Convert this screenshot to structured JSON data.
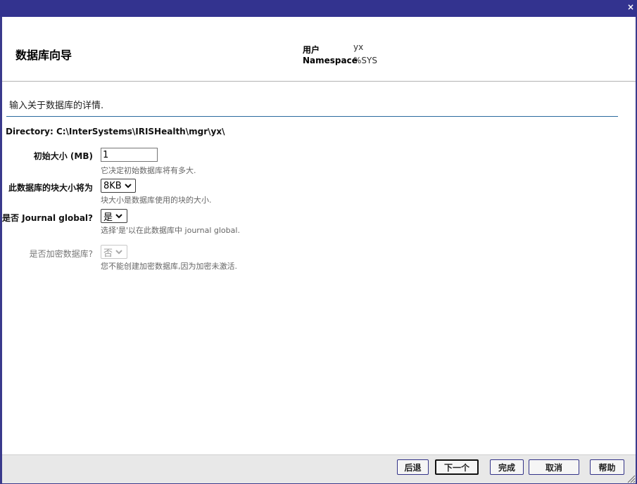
{
  "window": {
    "close_glyph": "×"
  },
  "header": {
    "title": "数据库向导",
    "user_label": "用户",
    "user_value": "yx",
    "namespace_label": "Namespace",
    "namespace_value": "%SYS"
  },
  "intro_text": "输入关于数据库的详情.",
  "directory_text": "Directory: C:\\InterSystems\\IRISHealth\\mgr\\yx\\",
  "form": {
    "initial_size": {
      "label": "初始大小 (MB)",
      "value": "1",
      "hint": "它决定初始数据库将有多大."
    },
    "block_size": {
      "label": "此数据库的块大小将为",
      "value": "8KB",
      "hint": "块大小是数据库使用的块的大小."
    },
    "journal": {
      "label": "是否 Journal global?",
      "value": "是",
      "hint": "选择'是'以在此数据库中 journal global."
    },
    "encrypt": {
      "label": "是否加密数据库?",
      "value": "否",
      "hint": "您不能创建加密数据库,因为加密未激活."
    }
  },
  "footer": {
    "back_label": "后退",
    "next_label": "下一个",
    "finish_label": "完成",
    "cancel_label": "取消",
    "help_label": "帮助"
  },
  "colors": {
    "titlebar": "#33338f",
    "divider": "#2b6b9e",
    "button_border": "#333388"
  },
  "icons": [
    "close-icon",
    "chevron-down-icon",
    "resize-grip-icon"
  ]
}
